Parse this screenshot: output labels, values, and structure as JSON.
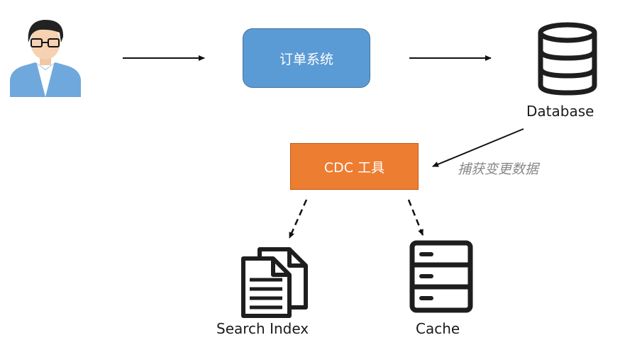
{
  "nodes": {
    "order_system": "订单系统",
    "database": "Database",
    "cdc_tool": "CDC 工具",
    "search_index": "Search Index",
    "cache": "Cache"
  },
  "edges": {
    "capture_label": "捕获变更数据"
  },
  "icons": {
    "user": "user-icon",
    "database": "database-icon",
    "search_index": "documents-icon",
    "cache": "server-icon"
  },
  "colors": {
    "order_system_fill": "#5b9bd5",
    "cdc_fill": "#ed7d31",
    "user_shirt": "#6fa8dc",
    "icon_dark": "#1e1e1e"
  }
}
